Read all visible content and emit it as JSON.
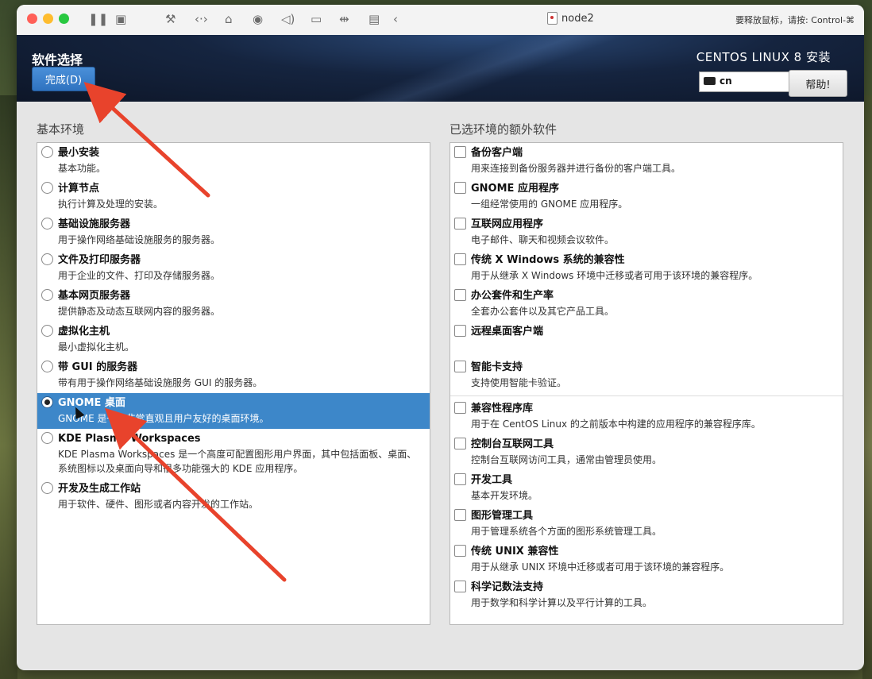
{
  "window": {
    "title": "node2",
    "hint": "要释放鼠标，请按: Control-⌘"
  },
  "toolbar_icons": [
    "pause-icon",
    "snapshot-icon",
    "wrench-icon",
    "code-icon",
    "drive-icon",
    "user-icon",
    "speaker-icon",
    "camera-icon",
    "usb-icon",
    "folder-icon",
    "back-icon"
  ],
  "header": {
    "spoke_title": "软件选择",
    "done_label": "完成(D)",
    "product_title": "CENTOS LINUX 8 安装",
    "keyboard_layout": "cn",
    "help_label": "帮助!"
  },
  "base_env": {
    "label": "基本环境",
    "items": [
      {
        "name": "最小安装",
        "desc": "基本功能。",
        "selected": false
      },
      {
        "name": "计算节点",
        "desc": "执行计算及处理的安装。",
        "selected": false
      },
      {
        "name": "基础设施服务器",
        "desc": "用于操作网络基础设施服务的服务器。",
        "selected": false
      },
      {
        "name": "文件及打印服务器",
        "desc": "用于企业的文件、打印及存储服务器。",
        "selected": false
      },
      {
        "name": "基本网页服务器",
        "desc": "提供静态及动态互联网内容的服务器。",
        "selected": false
      },
      {
        "name": "虚拟化主机",
        "desc": "最小虚拟化主机。",
        "selected": false
      },
      {
        "name": "带 GUI 的服务器",
        "desc": "带有用于操作网络基础设施服务 GUI 的服务器。",
        "selected": false
      },
      {
        "name": "GNOME 桌面",
        "desc": "GNOME 是一个非常直观且用户友好的桌面环境。",
        "selected": true
      },
      {
        "name": "KDE Plasma Workspaces",
        "desc": "KDE Plasma Workspaces 是一个高度可配置图形用户界面，其中包括面板、桌面、系统图标以及桌面向导和很多功能强大的 KDE 应用程序。",
        "selected": false
      },
      {
        "name": "开发及生成工作站",
        "desc": "用于软件、硬件、图形或者内容开发的工作站。",
        "selected": false
      }
    ]
  },
  "addons": {
    "label": "已选环境的额外软件",
    "items": [
      {
        "name": "备份客户端",
        "desc": "用来连接到备份服务器并进行备份的客户端工具。"
      },
      {
        "name": "GNOME 应用程序",
        "desc": "一组经常使用的 GNOME 应用程序。"
      },
      {
        "name": "互联网应用程序",
        "desc": "电子邮件、聊天和视频会议软件。"
      },
      {
        "name": "传统 X Windows 系统的兼容性",
        "desc": "用于从继承 X Windows 环境中迁移或者可用于该环境的兼容程序。"
      },
      {
        "name": "办公套件和生产率",
        "desc": "全套办公套件以及其它产品工具。"
      },
      {
        "name": "远程桌面客户端",
        "desc": ""
      },
      {
        "name": "智能卡支持",
        "desc": "支持使用智能卡验证。"
      },
      {
        "name": "兼容性程序库",
        "desc": "用于在 CentOS Linux 的之前版本中构建的应用程序的兼容程序库。"
      },
      {
        "name": "控制台互联网工具",
        "desc": "控制台互联网访问工具，通常由管理员使用。"
      },
      {
        "name": "开发工具",
        "desc": "基本开发环境。"
      },
      {
        "name": "图形管理工具",
        "desc": "用于管理系统各个方面的图形系统管理工具。"
      },
      {
        "name": "传统 UNIX 兼容性",
        "desc": "用于从继承 UNIX 环境中迁移或者可用于该环境的兼容程序。"
      },
      {
        "name": "科学记数法支持",
        "desc": "用于数学和科学计算以及平行计算的工具。"
      }
    ]
  },
  "colors": {
    "accent": "#3d87c9",
    "annotation_arrow": "#e8432c"
  }
}
